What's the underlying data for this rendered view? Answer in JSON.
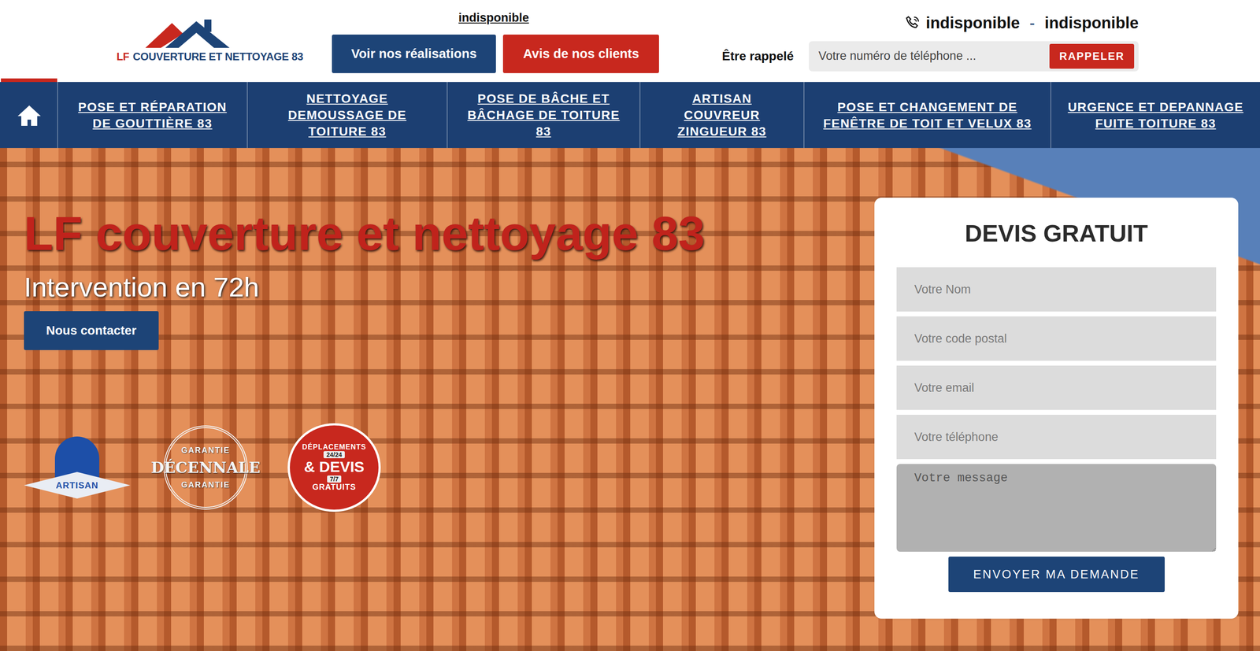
{
  "header": {
    "top_link": "indisponible",
    "buttons": [
      {
        "label": "Voir nos réalisations",
        "kind": "blue"
      },
      {
        "label": "Avis de nos clients",
        "kind": "red"
      }
    ],
    "phones": [
      "indisponible",
      "indisponible"
    ],
    "phone_separator": "-",
    "callback": {
      "label": "Être rappelé",
      "placeholder": "Votre numéro de téléphone ...",
      "button": "RAPPELER"
    }
  },
  "logo": {
    "prefix": "LF",
    "name": "COUVERTURE ET NETTOYAGE 83"
  },
  "nav": {
    "home": {
      "selected": true
    },
    "items": [
      {
        "label": "POSE ET RÉPARATION DE GOUTTIÈRE 83",
        "selected": false
      },
      {
        "label": "NETTOYAGE DEMOUSSAGE DE TOITURE 83",
        "selected": false
      },
      {
        "label": "POSE DE BÂCHE ET BÂCHAGE DE TOITURE 83",
        "selected": false
      },
      {
        "label": "ARTISAN COUVREUR ZINGUEUR 83",
        "selected": false
      },
      {
        "label": "POSE ET CHANGEMENT DE FENÊTRE DE TOIT ET VELUX 83",
        "selected": false
      },
      {
        "label": "URGENCE ET DEPANNAGE FUITE TOITURE 83",
        "selected": false
      }
    ]
  },
  "hero": {
    "title": "LF couverture et nettoyage 83",
    "subtitle": "Intervention en 72h",
    "button": "Nous contacter",
    "badges": [
      {
        "kind": "artisan",
        "lines": [
          "ARTISAN"
        ]
      },
      {
        "kind": "stamp",
        "lines": [
          "GARANTIE",
          "DÉCENNALE",
          "GARANTIE"
        ]
      },
      {
        "kind": "ribbon",
        "lines": [
          "DÉPLACEMENTS",
          "24/24",
          "& DEVIS",
          "7/7",
          "GRATUITS"
        ]
      }
    ]
  },
  "form": {
    "title": "DEVIS GRATUIT",
    "fields": [
      {
        "placeholder": "Votre Nom",
        "kind": "input"
      },
      {
        "placeholder": "Votre code postal",
        "kind": "input"
      },
      {
        "placeholder": "Votre email",
        "kind": "input"
      },
      {
        "placeholder": "Votre téléphone",
        "kind": "input"
      },
      {
        "placeholder": "Votre message",
        "kind": "textarea"
      }
    ],
    "button": "ENVOYER MA DEMANDE"
  }
}
